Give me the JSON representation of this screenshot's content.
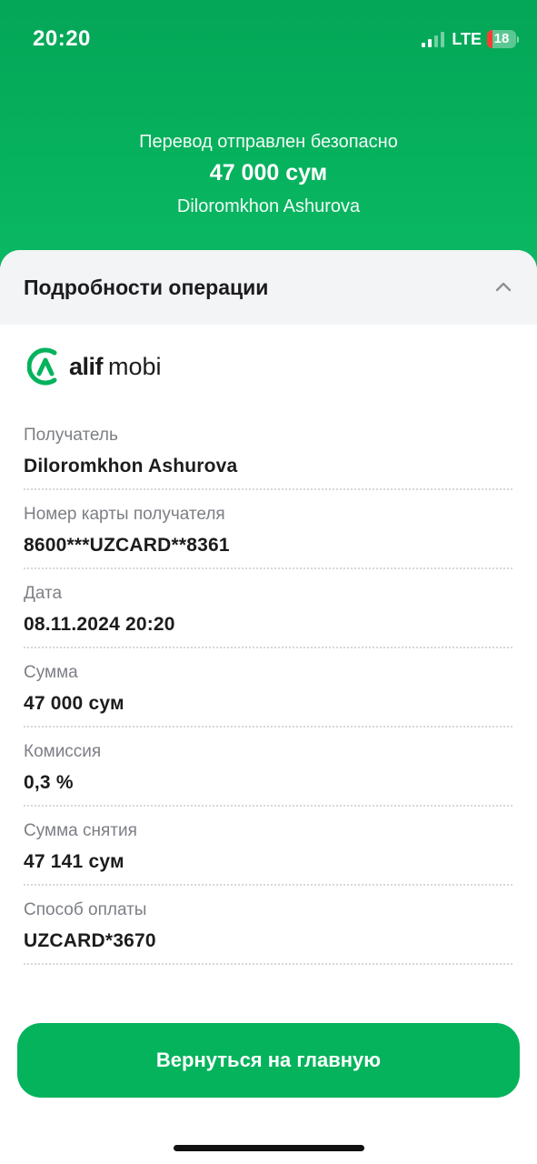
{
  "status_bar": {
    "time": "20:20",
    "network": "LTE",
    "battery_level": "18",
    "icons": [
      "signal-icon",
      "battery-icon"
    ]
  },
  "header": {
    "subtitle": "Перевод отправлен безопасно",
    "amount": "47 000 сум",
    "recipient": "Diloromkhon Ashurova"
  },
  "details": {
    "title": "Подробности операции",
    "logo": {
      "brand": "alif",
      "rest": "mobi"
    },
    "rows": [
      {
        "label": "Получатель",
        "value": "Diloromkhon Ashurova"
      },
      {
        "label": "Номер карты получателя",
        "value": "8600***UZCARD**8361"
      },
      {
        "label": "Дата",
        "value": "08.11.2024 20:20"
      },
      {
        "label": "Сумма",
        "value": "47 000 сум"
      },
      {
        "label": "Комиссия",
        "value": "0,3 %"
      },
      {
        "label": "Сумма снятия",
        "value": "47 141 сум"
      },
      {
        "label": "Способ оплаты",
        "value": "UZCARD*3670"
      }
    ]
  },
  "actions": {
    "home_button": "Вернуться на главную"
  },
  "colors": {
    "brand_green": "#04b35c",
    "header_green": "#06b15d",
    "label_gray": "#7d7f86",
    "sheet_head_bg": "#f3f4f6"
  }
}
